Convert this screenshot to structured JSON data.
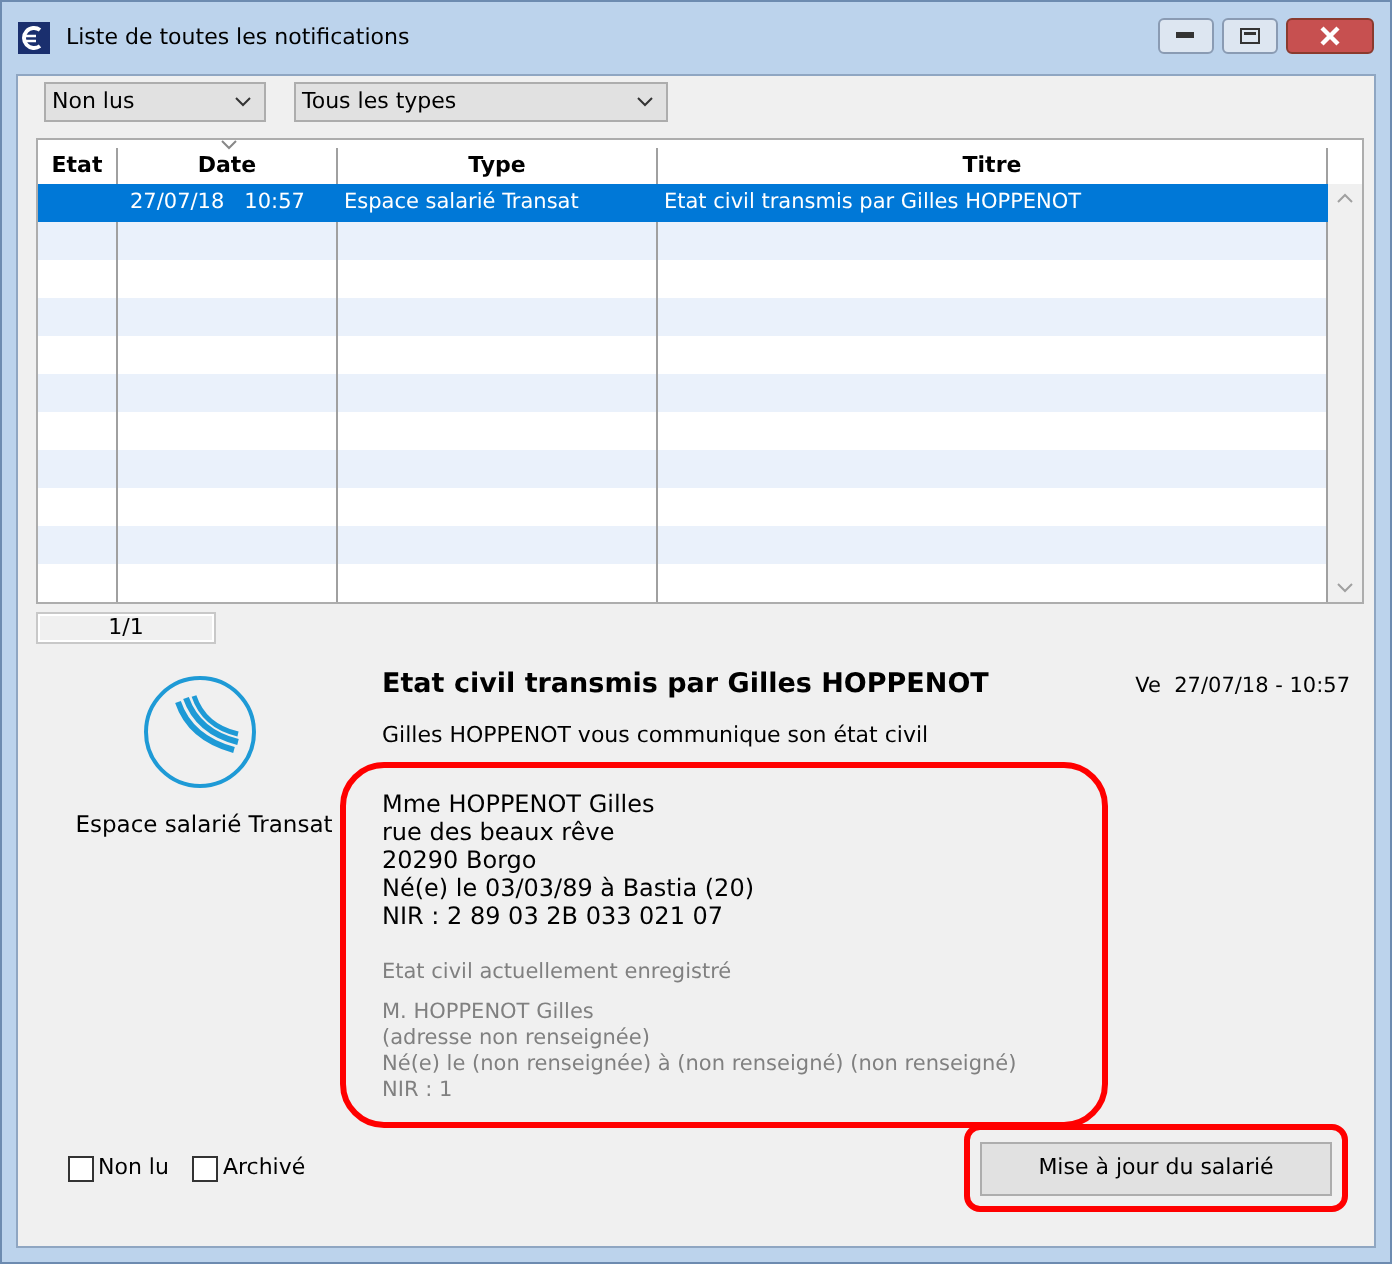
{
  "window": {
    "title": "Liste de toutes les notifications"
  },
  "filters": [
    {
      "value": "Non lus"
    },
    {
      "value": "Tous les types"
    }
  ],
  "table": {
    "columns": [
      "Etat",
      "Date",
      "Type",
      "Titre"
    ],
    "rows": [
      {
        "selected": true,
        "cells": [
          "",
          "27/07/18   10:57",
          "Espace salarié Transat",
          "Etat civil transmis par Gilles HOPPENOT"
        ]
      }
    ]
  },
  "pager": "1/1",
  "detail": {
    "source": "Espace salarié Transat",
    "title": "Etat civil transmis par Gilles HOPPENOT",
    "date": "Ve  27/07/18 - 10:57",
    "intro": "Gilles HOPPENOT vous communique son état civil",
    "highlighted": true,
    "new_lines": [
      "Mme HOPPENOT Gilles",
      "rue des beaux rêve",
      "20290 Borgo",
      "Né(e) le 03/03/89 à Bastia (20)",
      "NIR : 2 89 03 2B 033 021 07"
    ],
    "current_heading": "Etat civil actuellement enregistré",
    "current_lines": [
      "M. HOPPENOT Gilles",
      "(adresse non renseignée)",
      "Né(e) le (non renseignée) à (non renseigné) (non renseigné)",
      "NIR : 1"
    ]
  },
  "checkboxes": [
    {
      "label": "Non lu",
      "checked": false
    },
    {
      "label": "Archivé",
      "checked": false
    }
  ],
  "action_button": {
    "label": "Mise à jour du salarié",
    "highlighted": true
  }
}
